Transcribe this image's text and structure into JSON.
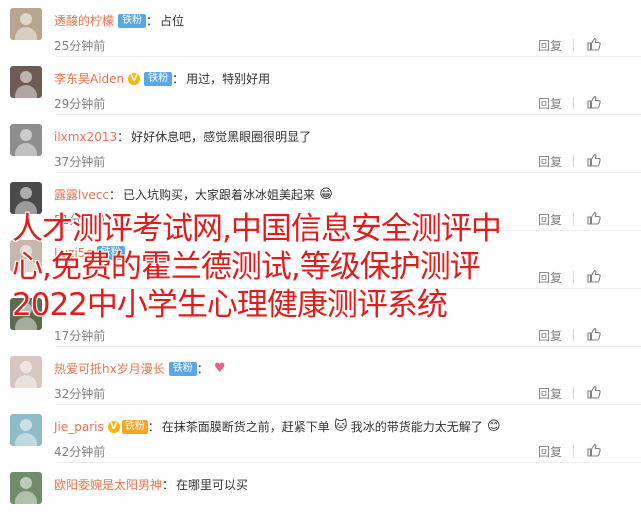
{
  "actions": {
    "reply_label": "回复"
  },
  "comments": [
    {
      "user": "透酸的柠檬",
      "badge": "铁粉",
      "verified": false,
      "level": "",
      "text": "占位",
      "emoji": "",
      "emoji2": "",
      "time": "25分钟前",
      "avatar_color": "#b9a48d"
    },
    {
      "user": "李东昊Aiden",
      "badge": "铁粉",
      "verified": true,
      "level": "",
      "text": "用过，特别好用",
      "emoji": "",
      "emoji2": "",
      "time": "29分钟前",
      "avatar_color": "#6f5b52"
    },
    {
      "user": "ilxmx2013",
      "badge": "",
      "verified": false,
      "level": "",
      "text": "好好休息吧，感觉黑眼圈很明显了",
      "emoji": "",
      "emoji2": "",
      "time": "37分钟前",
      "avatar_color": "#8e8e8e"
    },
    {
      "user": "露露lvecc",
      "badge": "",
      "verified": false,
      "level": "",
      "text": "已入坑购买，大家跟着冰冰姐美起来",
      "emoji": "grinning-face",
      "emoji2": "",
      "time": "51分钟前",
      "avatar_color": "#4a4a4a"
    },
    {
      "user": "Luzi5e",
      "badge": "铁粉",
      "verified": false,
      "level": "",
      "text": "...",
      "emoji": "",
      "emoji2": "",
      "time": "",
      "avatar_color": "#c7b7aa"
    },
    {
      "user": "",
      "badge": "",
      "verified": false,
      "level": "",
      "text": "",
      "emoji": "",
      "emoji2": "",
      "time": "17分钟前",
      "avatar_color": "#5c6b4f"
    },
    {
      "user": "热爱可抵hx岁月漫长",
      "badge": "铁粉",
      "verified": false,
      "level": "",
      "text": "",
      "emoji": "heart",
      "emoji2": "",
      "time": "32分钟前",
      "avatar_color": "#d9c6c0"
    },
    {
      "user": "Jie_paris",
      "badge": "",
      "verified": true,
      "level": "铁粉",
      "text": "在抹茶面膜断货之前，赶紧下单",
      "emoji": "cat-face",
      "emoji2": "smile-face",
      "text2": "我冰的带货能力太无解了",
      "time": "42分钟前",
      "avatar_color": "#8fbcc9"
    },
    {
      "user": "欧阳委婉是太阳男神",
      "badge": "",
      "verified": false,
      "level": "",
      "text": "在哪里可以买",
      "emoji": "",
      "emoji2": "",
      "time": "",
      "avatar_color": "#708d6a"
    }
  ],
  "overlay": {
    "line1": "人才测评考试网,中国信息安全测评中",
    "line2": "心,免费的霍兰德测试,等级保护测评",
    "line3": "2022中小学生心理健康测评系统"
  },
  "icons": {
    "like": "thumbs-up-icon",
    "emoji": [
      "grinning-face",
      "heart",
      "cat-face",
      "smile-face"
    ]
  }
}
